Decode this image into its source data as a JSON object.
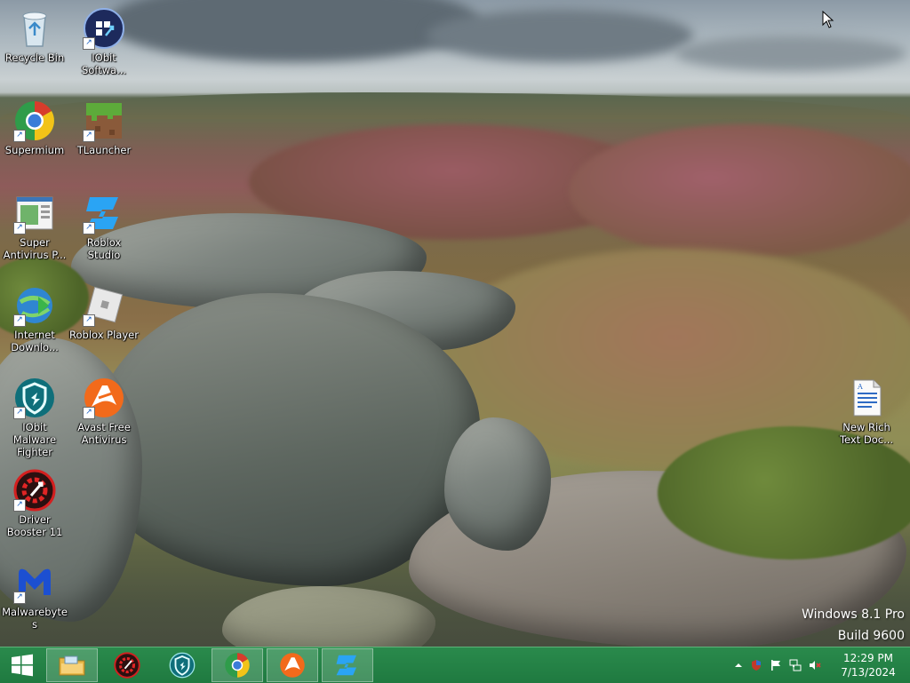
{
  "desktop_icons": [
    {
      "id": "recycle-bin",
      "label": "Recycle Bin",
      "icon": "recycle-bin-icon",
      "shortcut": false
    },
    {
      "id": "iobit-software",
      "label": "IObit Softwa...",
      "icon": "iobit-software-icon",
      "shortcut": true
    },
    {
      "id": "supermium",
      "label": "Supermium",
      "icon": "supermium-icon",
      "shortcut": true
    },
    {
      "id": "tlauncher",
      "label": "TLauncher",
      "icon": "tlauncher-icon",
      "shortcut": true
    },
    {
      "id": "super-antivirus",
      "label": "Super Antivirus P...",
      "icon": "super-antivirus-icon",
      "shortcut": true
    },
    {
      "id": "roblox-studio",
      "label": "Roblox Studio",
      "icon": "roblox-studio-icon",
      "shortcut": true
    },
    {
      "id": "internet-download",
      "label": "Internet Downlo...",
      "icon": "internet-download-manager-icon",
      "shortcut": true
    },
    {
      "id": "roblox-player",
      "label": "Roblox Player",
      "icon": "roblox-player-icon",
      "shortcut": true
    },
    {
      "id": "iobit-malware",
      "label": "IObit Malware Fighter",
      "icon": "iobit-malware-fighter-icon",
      "shortcut": true
    },
    {
      "id": "avast",
      "label": "Avast Free Antivirus",
      "icon": "avast-icon",
      "shortcut": true
    },
    {
      "id": "driver-booster",
      "label": "Driver Booster 11",
      "icon": "driver-booster-icon",
      "shortcut": true
    },
    {
      "id": "malwarebytes",
      "label": "Malwarebytes",
      "icon": "malwarebytes-icon",
      "shortcut": true
    },
    {
      "id": "new-rich-text",
      "label": "New Rich Text Doc...",
      "icon": "rich-text-document-icon",
      "shortcut": false
    }
  ],
  "watermark": {
    "edition": "Windows 8.1 Pro",
    "build": "Build 9600"
  },
  "taskbar": {
    "pinned": [
      {
        "name": "file-explorer",
        "icon": "folder-icon",
        "active": true
      },
      {
        "name": "driver-booster",
        "icon": "driver-booster-icon",
        "active": false
      },
      {
        "name": "iobit-malware-fighter",
        "icon": "iobit-malware-fighter-icon",
        "active": false
      },
      {
        "name": "supermium",
        "icon": "supermium-icon",
        "active": true
      },
      {
        "name": "avast",
        "icon": "avast-icon",
        "active": true
      },
      {
        "name": "roblox-studio",
        "icon": "roblox-studio-icon",
        "active": true
      }
    ],
    "tray_icons": [
      "show-hidden-icons-icon",
      "security-shield-icon",
      "action-center-flag-icon",
      "network-icon",
      "volume-muted-icon"
    ],
    "clock": {
      "time": "12:29 PM",
      "date": "7/13/2024"
    }
  },
  "colors": {
    "taskbar": "#1f7a40",
    "taskbar_highlight": "#5fb27a"
  }
}
